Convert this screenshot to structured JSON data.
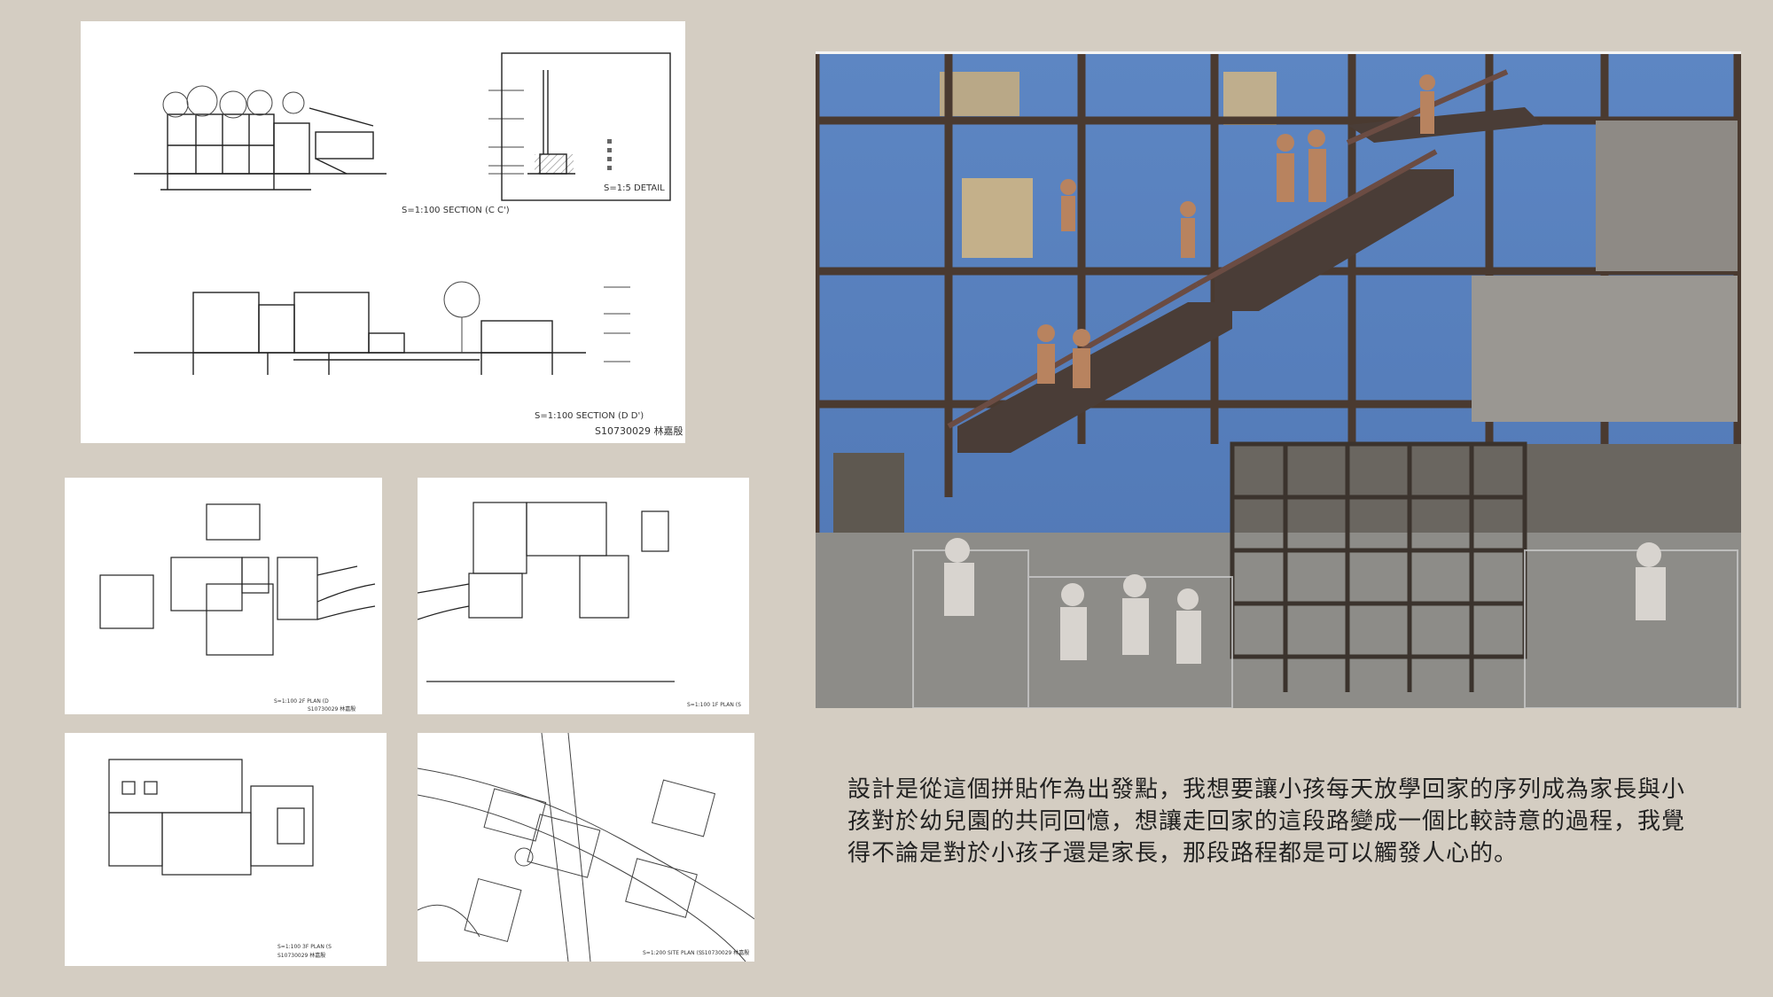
{
  "sections_sheet": {
    "section_cc_label": "S=1:100 SECTION (C C')",
    "detail_label": "S=1:5 DETAIL",
    "section_dd_label": "S=1:100 SECTION (D D')",
    "student_id": "S10730029 林嘉殷"
  },
  "plans": {
    "plan_1_label": "S=1:100 2F PLAN (D",
    "plan_1_id": "S10730029 林嘉殷",
    "plan_2_label": "S=1:100 1F PLAN (S",
    "plan_3_label": "S=1:100 3F PLAN (S",
    "plan_3_id": "S10730029 林嘉殷",
    "site_label": "S=1:200 SITE PLAN (S",
    "site_id": "S10730029 林嘉殷"
  },
  "collage": {
    "description": "photo collage of children climbing stairs and playground frames in front of a window grid"
  },
  "description": "設計是從這個拼貼作為出發點，我想要讓小孩每天放學回家的序列成為家長與小孩對於幼兒園的共同回憶，想讓走回家的這段路變成一個比較詩意的過程，我覺得不論是對於小孩子還是家長，那段路程都是可以觸發人心的。",
  "colors": {
    "background": "#d4cdc2",
    "sky": "#5f82b9",
    "frame": "#4a3a30"
  }
}
